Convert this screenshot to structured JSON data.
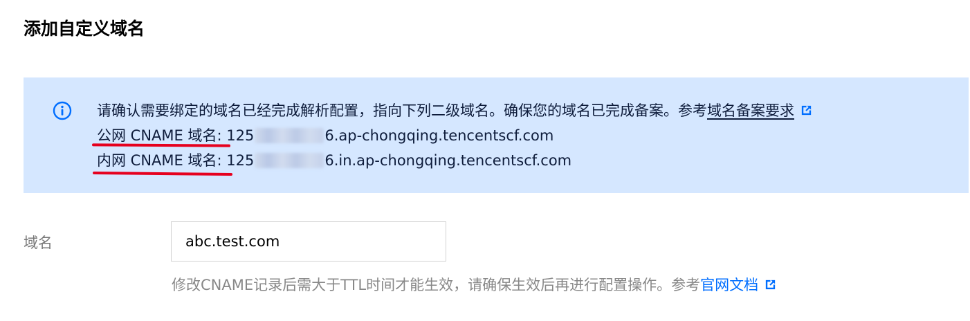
{
  "page_title": "添加自定义域名",
  "notice": {
    "icon": "info-icon",
    "message": "请确认需要绑定的域名已经完成解析配置，指向下列二级域名。确保您的域名已完成备案。参考",
    "link_label": "域名备案要求",
    "link_icon": "external-link-icon",
    "public_label": "公网 CNAME 域名",
    "public_prefix": ": 125",
    "public_suffix": "6.ap-chongqing.tencentscf.com",
    "private_label": "内网 CNAME 域名",
    "private_prefix": ": 125",
    "private_suffix": "6.in.ap-chongqing.tencentscf.com"
  },
  "form": {
    "domain_label": "域名",
    "domain_value": "abc.test.com",
    "help_text": "修改CNAME记录后需大于TTL时间才能生效，请确保生效后再进行配置操作。参考",
    "help_link_label": "官网文档",
    "help_link_icon": "external-link-icon"
  },
  "colors": {
    "notice_bg": "#d5e7ff",
    "accent": "#006eff",
    "annotation_red": "#e6001e"
  }
}
